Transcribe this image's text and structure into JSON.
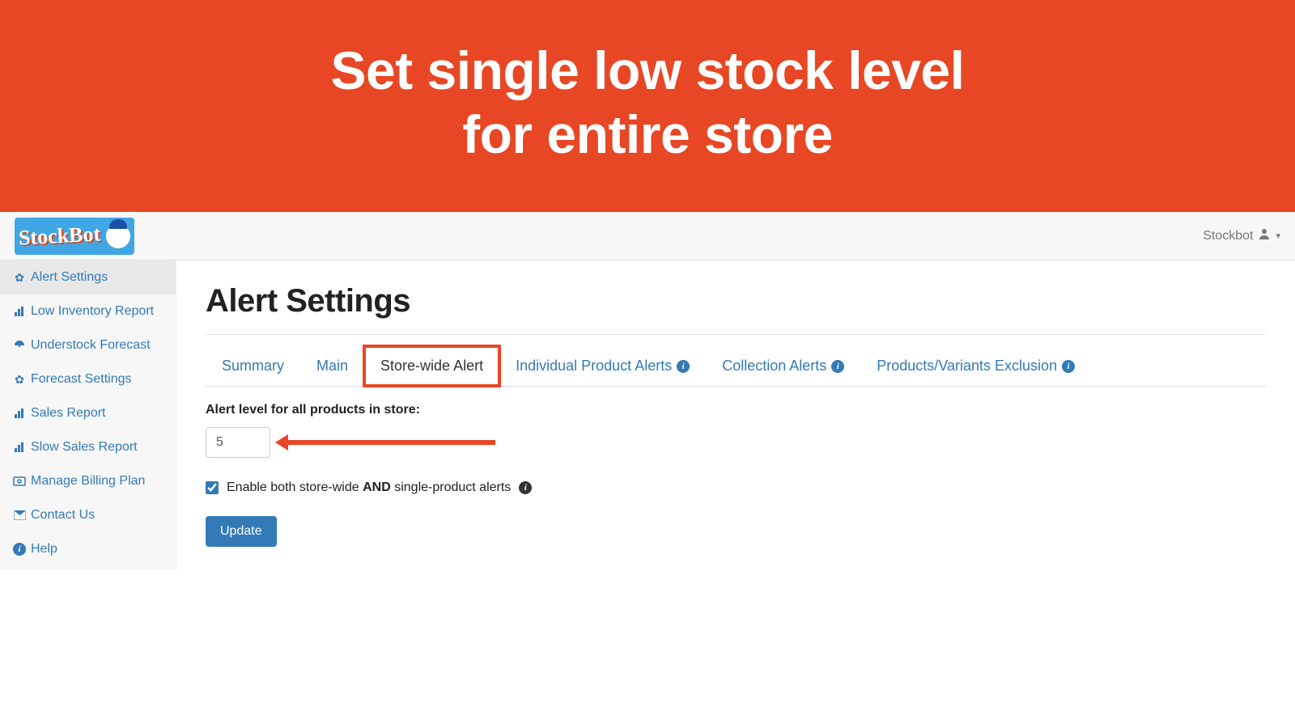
{
  "banner": {
    "line1": "Set single low stock level",
    "line2": "for entire store"
  },
  "brand": "StockBot",
  "user_menu": {
    "label": "Stockbot"
  },
  "sidebar": {
    "items": [
      {
        "label": "Alert Settings",
        "icon": "gear"
      },
      {
        "label": "Low Inventory Report",
        "icon": "bar-chart"
      },
      {
        "label": "Understock Forecast",
        "icon": "dashboard"
      },
      {
        "label": "Forecast Settings",
        "icon": "gear"
      },
      {
        "label": "Sales Report",
        "icon": "bar-chart"
      },
      {
        "label": "Slow Sales Report",
        "icon": "bar-chart"
      },
      {
        "label": "Manage Billing Plan",
        "icon": "cash"
      },
      {
        "label": "Contact Us",
        "icon": "envelope"
      },
      {
        "label": "Help",
        "icon": "info"
      }
    ]
  },
  "page": {
    "title": "Alert Settings"
  },
  "tabs": [
    {
      "label": "Summary"
    },
    {
      "label": "Main"
    },
    {
      "label": "Store-wide Alert",
      "active": true
    },
    {
      "label": "Individual Product Alerts",
      "info": true
    },
    {
      "label": "Collection Alerts",
      "info": true
    },
    {
      "label": "Products/Variants Exclusion",
      "info": true
    }
  ],
  "form": {
    "level_label": "Alert level for all products in store:",
    "level_value": "5",
    "checkbox_prefix": "Enable both store-wide ",
    "checkbox_bold": "AND",
    "checkbox_suffix": " single-product alerts ",
    "checkbox_checked": true,
    "submit_label": "Update"
  }
}
